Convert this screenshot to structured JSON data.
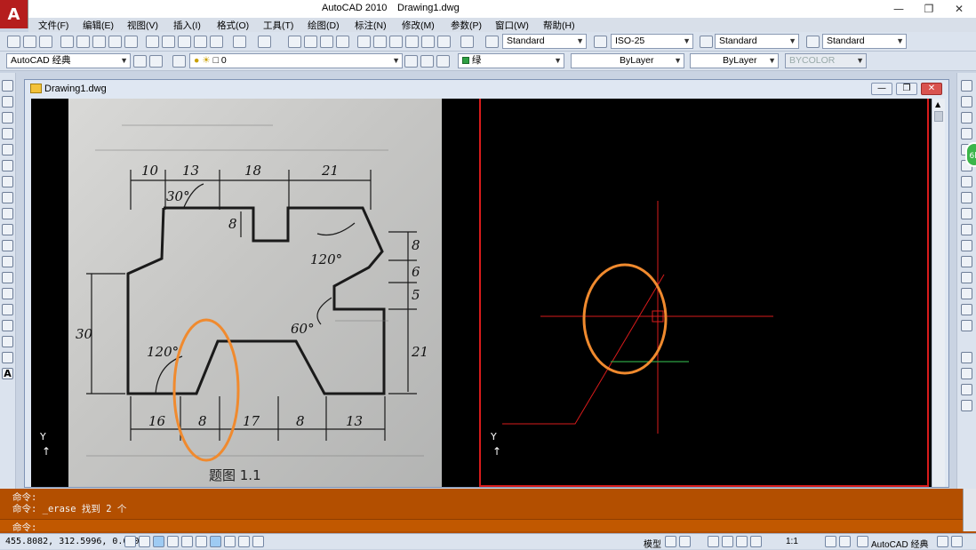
{
  "window": {
    "title": "AutoCAD 2010",
    "document": "Drawing1.dwg",
    "logo": "A"
  },
  "menu": [
    "文件(F)",
    "编辑(E)",
    "视图(V)",
    "插入(I)",
    "格式(O)",
    "工具(T)",
    "绘图(D)",
    "标注(N)",
    "修改(M)",
    "参数(P)",
    "窗口(W)",
    "帮助(H)"
  ],
  "toolbar1": {
    "text_style": "Standard",
    "dim_style": "ISO-25",
    "table_style": "Standard",
    "multileader_style": "Standard"
  },
  "toolbar2": {
    "workspace": "AutoCAD 经典",
    "layer": "0",
    "color": "绿",
    "linetype": "ByLayer",
    "lineweight": "ByLayer",
    "plotstyle": "BYCOLOR"
  },
  "doc_window": {
    "title": "Drawing1.dwg"
  },
  "photo": {
    "caption": "题图 1.1",
    "dims_top": [
      "10",
      "13",
      "18",
      "21"
    ],
    "dims_bottom": [
      "16",
      "8",
      "17",
      "8",
      "13"
    ],
    "dims_right": [
      "8",
      "6",
      "5",
      "21"
    ],
    "dim_left": "30",
    "dim_notch": "8",
    "angles": [
      "30°",
      "120°",
      "60°",
      "120°"
    ]
  },
  "ucs": {
    "left_label": "Y",
    "right_label": "Y"
  },
  "command": {
    "line1": "命令:",
    "line2": "命令: _erase 找到 2 个",
    "prompt": "命令:"
  },
  "status": {
    "coords": "455.8082, 312.5996, 0.0000",
    "model": "模型",
    "scale": "1:1",
    "workspace": "AutoCAD 经典"
  },
  "badge": "6k",
  "colors": {
    "accent": "#b34f00",
    "highlight": "#f08a2e",
    "crosshair": "#d81b1b",
    "green_line": "#2ea043"
  }
}
